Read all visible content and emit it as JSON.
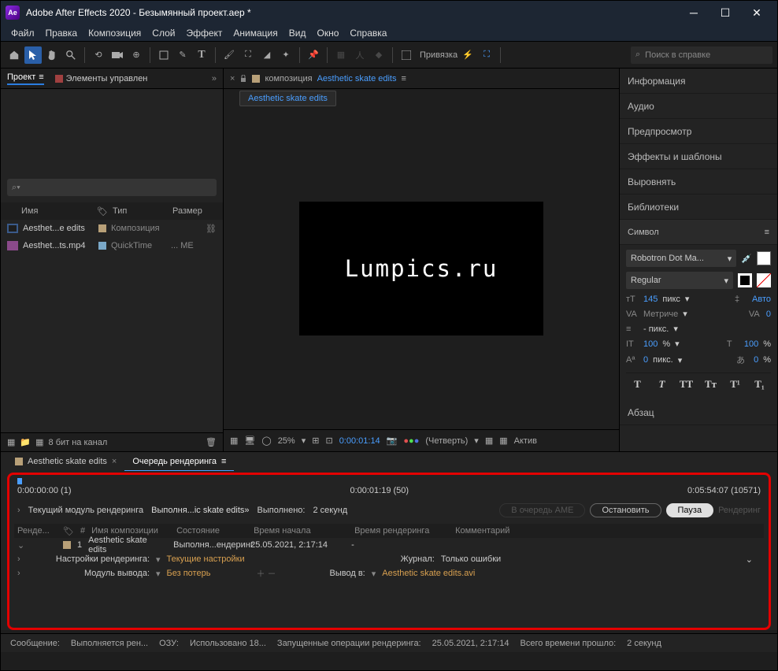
{
  "title": "Adobe After Effects 2020 - Безымянный проект.aep *",
  "menu": [
    "Файл",
    "Правка",
    "Композиция",
    "Слой",
    "Эффект",
    "Анимация",
    "Вид",
    "Окно",
    "Справка"
  ],
  "snap": "Привязка",
  "search_placeholder": "Поиск в справке",
  "left": {
    "tab_project": "Проект",
    "tab_controls": "Элементы управлен",
    "col_name": "Имя",
    "col_type": "Тип",
    "col_size": "Размер",
    "rows": [
      {
        "name": "Aesthet...e edits",
        "type": "Композиция"
      },
      {
        "name": "Aesthet...ts.mp4",
        "type": "QuickTime",
        "size": "... ME"
      }
    ],
    "bit": "8 бит на канал"
  },
  "center": {
    "label": "композиция",
    "name": "Aesthetic skate edits",
    "tab": "Aesthetic skate edits",
    "canvas_text": "Lumpics.ru",
    "zoom": "25%",
    "time": "0:00:01:14",
    "quality": "(Четверть)",
    "active": "Актив"
  },
  "right": {
    "panels": [
      "Информация",
      "Аудио",
      "Предпросмотр",
      "Эффекты и шаблоны",
      "Выровнять",
      "Библиотеки"
    ],
    "char_title": "Символ",
    "font": "Robotron Dot Ma...",
    "style": "Regular",
    "size_val": "145",
    "size_unit": "пикс",
    "leading": "Авто",
    "kerning": "Метриче",
    "tracking": "0",
    "baseline_unit": "- пикс.",
    "vscale": "100",
    "hscale": "100",
    "baseline": "0",
    "tsume": "0",
    "pct": "%",
    "px": "пикс.",
    "para": "Абзац"
  },
  "timeline": {
    "tab1": "Aesthetic skate edits",
    "tab2": "Очередь рендеринга",
    "t_start": "0:00:00:00 (1)",
    "t_mid": "0:00:01:19 (50)",
    "t_end": "0:05:54:07 (10571)",
    "current_label": "Текущий модуль рендеринга",
    "executing": "Выполня...ic skate edits»",
    "done_label": "Выполнено:",
    "done_val": "2 секунд",
    "btn_ame": "В очередь AME",
    "btn_stop": "Остановить",
    "btn_pause": "Пауза",
    "btn_render": "Рендеринг",
    "cols": {
      "render": "Ренде...",
      "num": "#",
      "comp": "Имя композиции",
      "state": "Состояние",
      "start": "Время начала",
      "rtime": "Время рендеринга",
      "comment": "Комментарий"
    },
    "row": {
      "num": "1",
      "name": "Aesthetic skate edits",
      "state": "Выполня...ендеринг",
      "start": "25.05.2021, 2:17:14",
      "rtime": "-"
    },
    "settings_label": "Настройки рендеринга:",
    "settings_val": "Текущие настройки",
    "journal_label": "Журнал:",
    "journal_val": "Только ошибки",
    "output_module": "Модуль вывода:",
    "output_val": "Без потерь",
    "output_to": "Вывод в:",
    "output_file": "Aesthetic skate edits.avi"
  },
  "status": {
    "msg_label": "Сообщение:",
    "msg": "Выполняется рен...",
    "ram_label": "ОЗУ:",
    "ram": "Использовано 18...",
    "ops_label": "Запущенные операции рендеринга:",
    "ops": "25.05.2021, 2:17:14",
    "elapsed_label": "Всего времени прошло:",
    "elapsed": "2 секунд"
  }
}
